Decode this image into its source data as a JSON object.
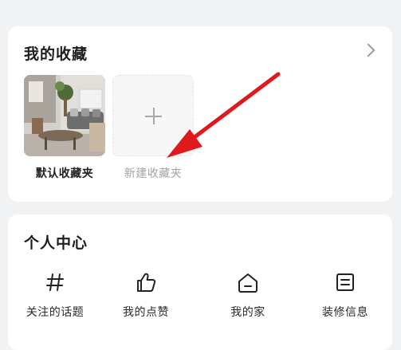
{
  "favorites": {
    "title": "我的收藏",
    "folders": [
      {
        "label": "默认收藏夹"
      },
      {
        "label": "新建收藏夹"
      }
    ]
  },
  "personal_center": {
    "title": "个人中心",
    "shortcuts": [
      {
        "label": "关注的话题",
        "icon": "hashtag-icon"
      },
      {
        "label": "我的点赞",
        "icon": "thumbs-up-icon"
      },
      {
        "label": "我的家",
        "icon": "home-icon"
      },
      {
        "label": "装修信息",
        "icon": "document-icon"
      }
    ]
  },
  "colors": {
    "background": "#f1f2f4",
    "card": "#ffffff",
    "arrow": "#e0191c"
  }
}
